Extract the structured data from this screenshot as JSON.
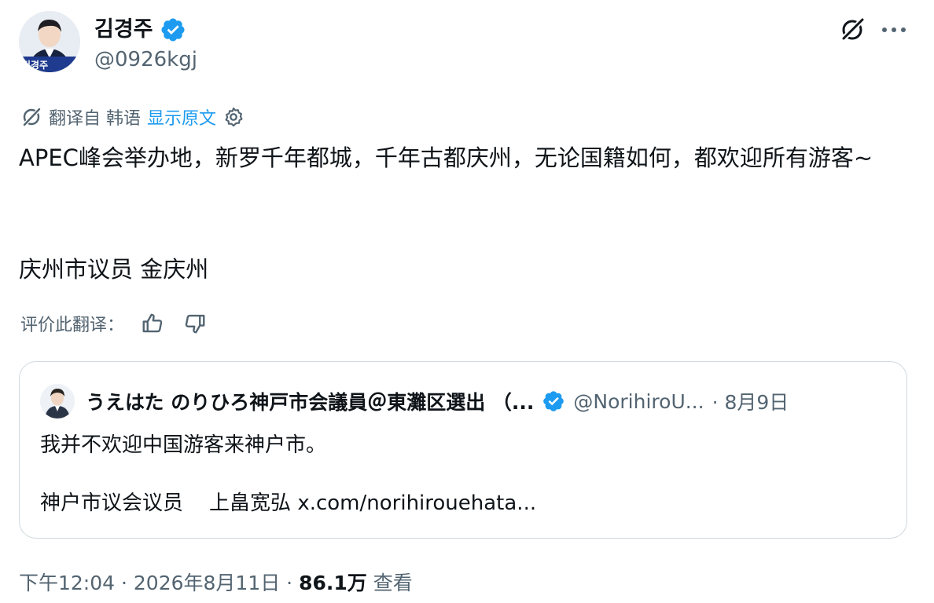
{
  "header": {
    "display_name": "김경주",
    "handle": "@0926kgj",
    "avatar_banner_text": "김경주"
  },
  "translation": {
    "label": "翻译自 韩语",
    "show_original": "显示原文"
  },
  "tweet": {
    "text": "APEC峰会举办地，新罗千年都城，千年古都庆州，无论国籍如何，都欢迎所有游客~",
    "signature": "庆州市议员 金庆州"
  },
  "rate": {
    "label": "评价此翻译："
  },
  "quote": {
    "display_name": "うえはた のりひろ神戸市会議員＠東灘区選出 （...",
    "handle": "@NorihiroU...",
    "date": "· 8月9日",
    "text": "我并不欢迎中国游客来神户市。",
    "signature": "神户市议会议员    上畠宽弘 x.com/norihirouehata..."
  },
  "meta": {
    "time": "下午12:04 · 2026年8月11日 · ",
    "views": "86.1万",
    "views_label": " 查看"
  },
  "colors": {
    "accent": "#1d9bf0",
    "text_primary": "#0f1419",
    "text_secondary": "#536471",
    "border": "#cfd9de"
  },
  "icons": [
    "grok-icon",
    "more-icon",
    "translate-icon",
    "settings-icon",
    "thumbs-up-icon",
    "thumbs-down-icon",
    "verified-badge-icon"
  ]
}
